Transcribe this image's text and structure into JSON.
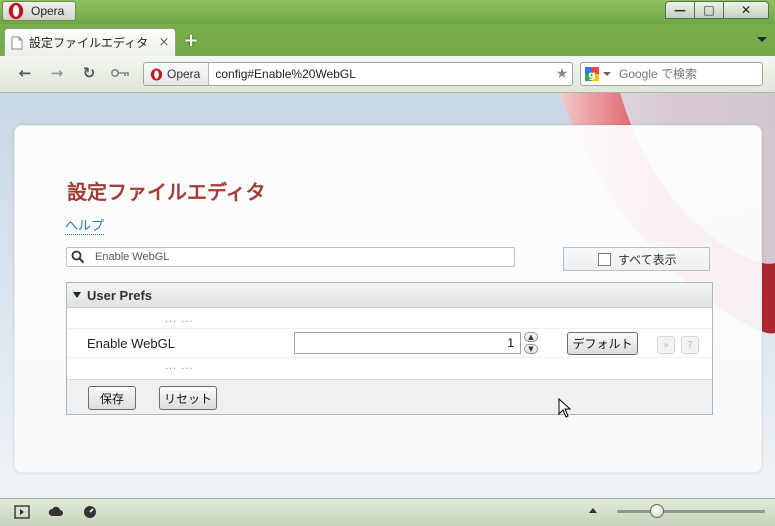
{
  "window": {
    "app_button_label": "Opera",
    "controls": {
      "minimize": "—",
      "maximize": "□",
      "close": "✕"
    }
  },
  "tabs": [
    {
      "label": "設定ファイルエディタ",
      "close": "×"
    }
  ],
  "new_tab": "+",
  "toolbar": {
    "back": "←",
    "forward": "→",
    "reload": "↻",
    "site_badge": "Opera",
    "url": "config#Enable%20WebGL",
    "star": "★",
    "search_placeholder": "Google で検索"
  },
  "page": {
    "title": "設定ファイルエディタ",
    "help": "ヘルプ",
    "filter_value": "Enable WebGL",
    "show_all": "すべて表示",
    "section_title": "User Prefs",
    "ellipsis": "... ...",
    "pref": {
      "name": "Enable WebGL",
      "value": "1",
      "default_button": "デフォルト",
      "mini1": "»",
      "mini2": "?"
    },
    "save_button": "保存",
    "reset_button": "リセット"
  },
  "colors": {
    "title": "#a33b37",
    "link": "#2a74b5",
    "chrome_green": "#6ea645"
  }
}
